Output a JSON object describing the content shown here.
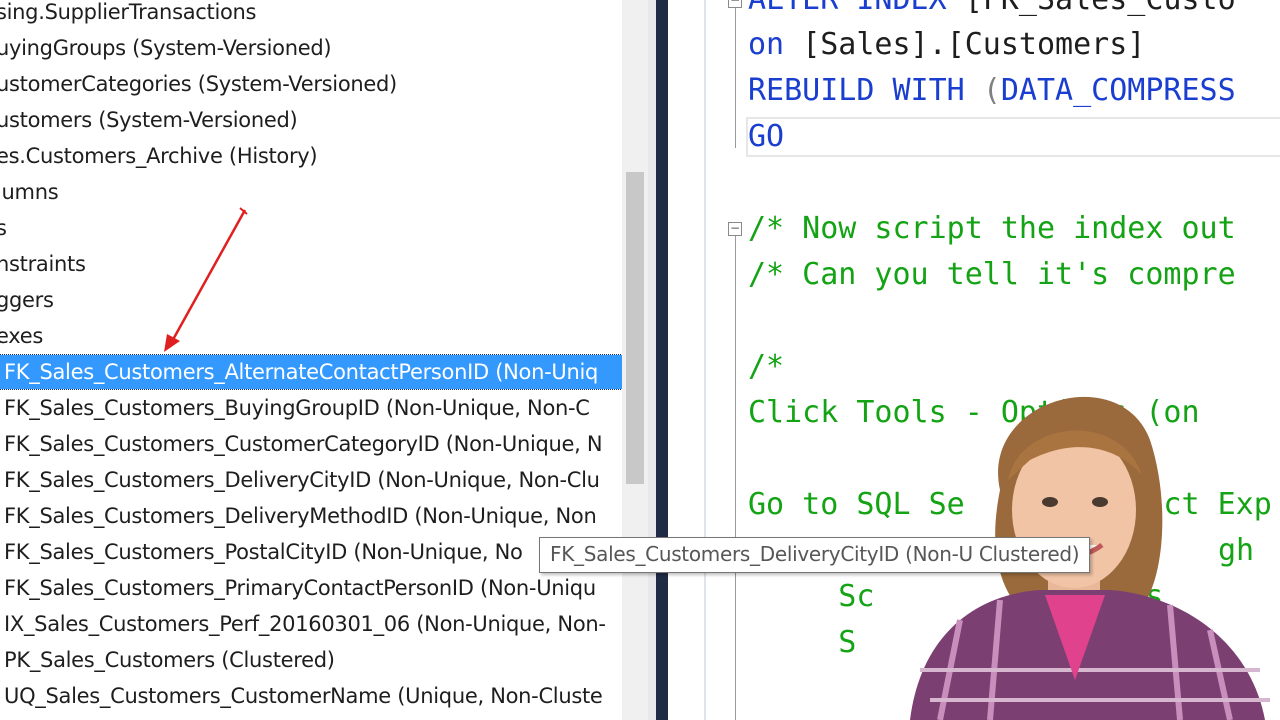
{
  "explorer": {
    "items": [
      {
        "label": "sing.SupplierTransactions"
      },
      {
        "label": "uyingGroups (System-Versioned)"
      },
      {
        "label": "ustomerCategories (System-Versioned)"
      },
      {
        "label": "ustomers (System-Versioned)"
      },
      {
        "label": "es.Customers_Archive (History)"
      },
      {
        "label": "lumns"
      },
      {
        "label": "s"
      },
      {
        "label": "nstraints"
      },
      {
        "label": "ggers"
      },
      {
        "label": "exes"
      },
      {
        "label": "FK_Sales_Customers_AlternateContactPersonID (Non-Uniq",
        "selected": true
      },
      {
        "label": "FK_Sales_Customers_BuyingGroupID (Non-Unique, Non-C"
      },
      {
        "label": "FK_Sales_Customers_CustomerCategoryID (Non-Unique, N"
      },
      {
        "label": "FK_Sales_Customers_DeliveryCityID (Non-Unique, Non-Clu"
      },
      {
        "label": "FK_Sales_Customers_DeliveryMethodID (Non-Unique, Non"
      },
      {
        "label": "FK_Sales_Customers_PostalCityID (Non-Unique, No"
      },
      {
        "label": "FK_Sales_Customers_PrimaryContactPersonID (Non-Uniqu"
      },
      {
        "label": "IX_Sales_Customers_Perf_20160301_06 (Non-Unique, Non-"
      },
      {
        "label": "PK_Sales_Customers (Clustered)"
      },
      {
        "label": "UQ_Sales_Customers_CustomerName (Unique, Non-Cluste"
      }
    ]
  },
  "tooltip": {
    "text": "FK_Sales_Customers_DeliveryCityID (Non-U          Clustered)"
  },
  "editor": {
    "line1": {
      "kw": "ALTER INDEX ",
      "plain": "[FK_Sales_Custo"
    },
    "line2": {
      "kw": "on ",
      "plain": "[Sales].[Customers]"
    },
    "line3": {
      "kw": "REBUILD WITH ",
      "gray": "(",
      "kw2": "DATA_COMPRESS"
    },
    "line4": {
      "kw": "GO"
    },
    "line5": "/* Now script the index out",
    "line6": "/* Can you tell it's compre",
    "line7": "/*",
    "line8": "Click Tools - Options (on",
    "line9": "Go to SQL Se          ect Exp",
    "line10": "gh",
    "line11": "     Sc          ompres",
    "line12": "     S          n Sc"
  },
  "colors": {
    "selection": "#3399ff",
    "keyword": "#1a3ecf",
    "comment": "#14a314",
    "annotation_arrow": "#e02020"
  },
  "icons": {
    "fold_marker": "minus-box-icon"
  }
}
